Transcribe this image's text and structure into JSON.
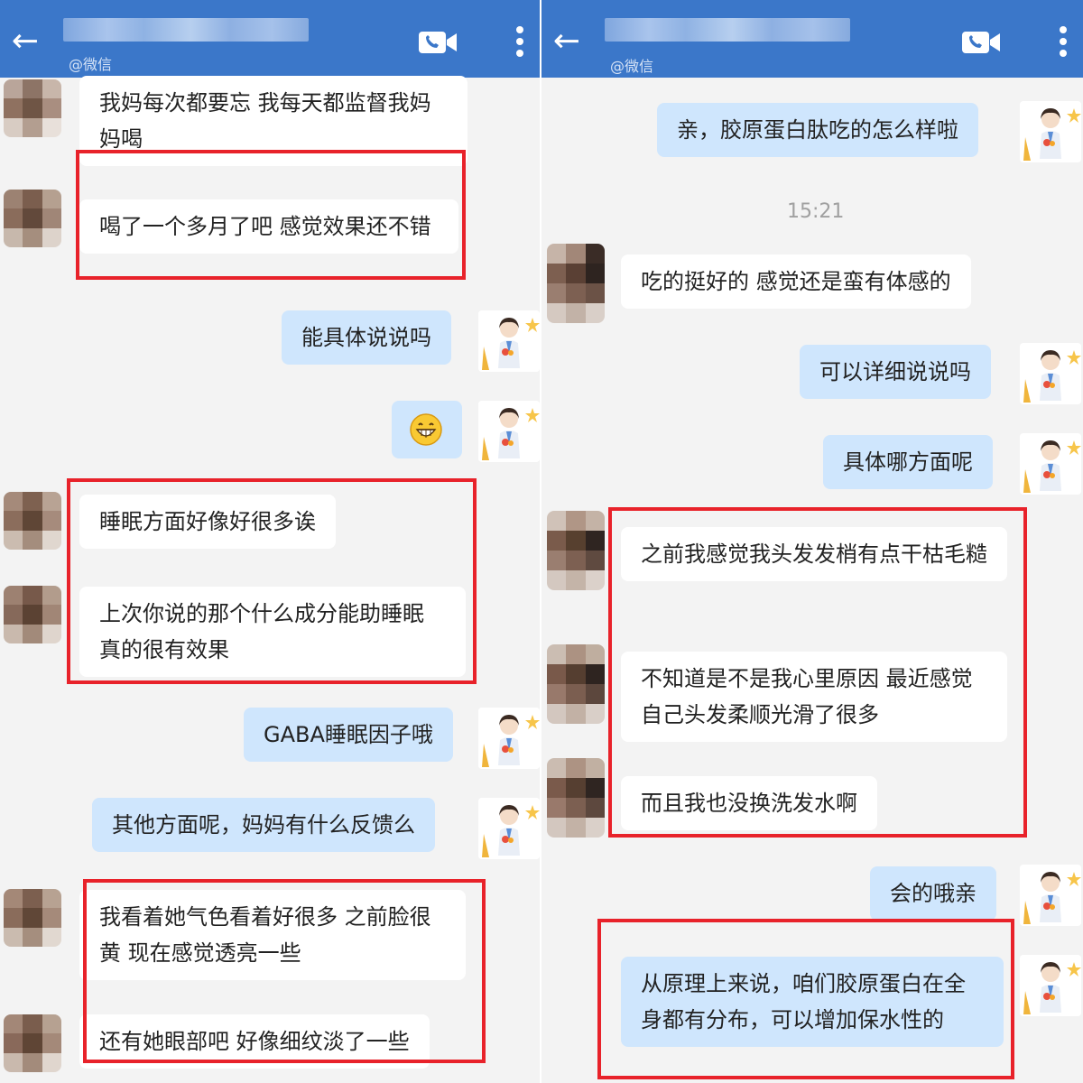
{
  "left": {
    "header": {
      "subtitle": "@微信"
    },
    "messages": [
      {
        "text": "我妈每次都要忘 我每天都监督我妈妈喝"
      },
      {
        "text": "喝了一个多月了吧 感觉效果还不错"
      },
      {
        "text": "能具体说说吗"
      },
      {
        "text": "睡眠方面好像好很多诶"
      },
      {
        "text": "上次你说的那个什么成分能助睡眠 真的很有效果"
      },
      {
        "text": "GABA睡眠因子哦"
      },
      {
        "text": "其他方面呢，妈妈有什么反馈么"
      },
      {
        "text": "我看着她气色看着好很多 之前脸很黄 现在感觉透亮一些"
      },
      {
        "text": "还有她眼部吧 好像细纹淡了一些"
      }
    ]
  },
  "right": {
    "header": {
      "subtitle": "@微信"
    },
    "time": "15:21",
    "messages": [
      {
        "text": "亲，胶原蛋白肽吃的怎么样啦"
      },
      {
        "text": "吃的挺好的 感觉还是蛮有体感的"
      },
      {
        "text": "可以详细说说吗"
      },
      {
        "text": "具体哪方面呢"
      },
      {
        "text": "之前我感觉我头发发梢有点干枯毛糙"
      },
      {
        "text": "不知道是不是我心里原因 最近感觉自己头发柔顺光滑了很多"
      },
      {
        "text": "而且我也没换洗发水啊"
      },
      {
        "text": "会的哦亲"
      },
      {
        "text": "从原理上来说，咱们胶原蛋白在全身都有分布，可以增加保水性的"
      }
    ]
  },
  "icons": {
    "back": "arrow-left-icon",
    "video_call": "video-call-icon",
    "more": "more-vertical-icon",
    "emoji": "grinning-emoji-icon"
  },
  "colors": {
    "header": "#3b77c9",
    "incoming_bubble": "#ffffff",
    "outgoing_bubble": "#cfe6fd",
    "highlight_box": "#e8222a"
  }
}
